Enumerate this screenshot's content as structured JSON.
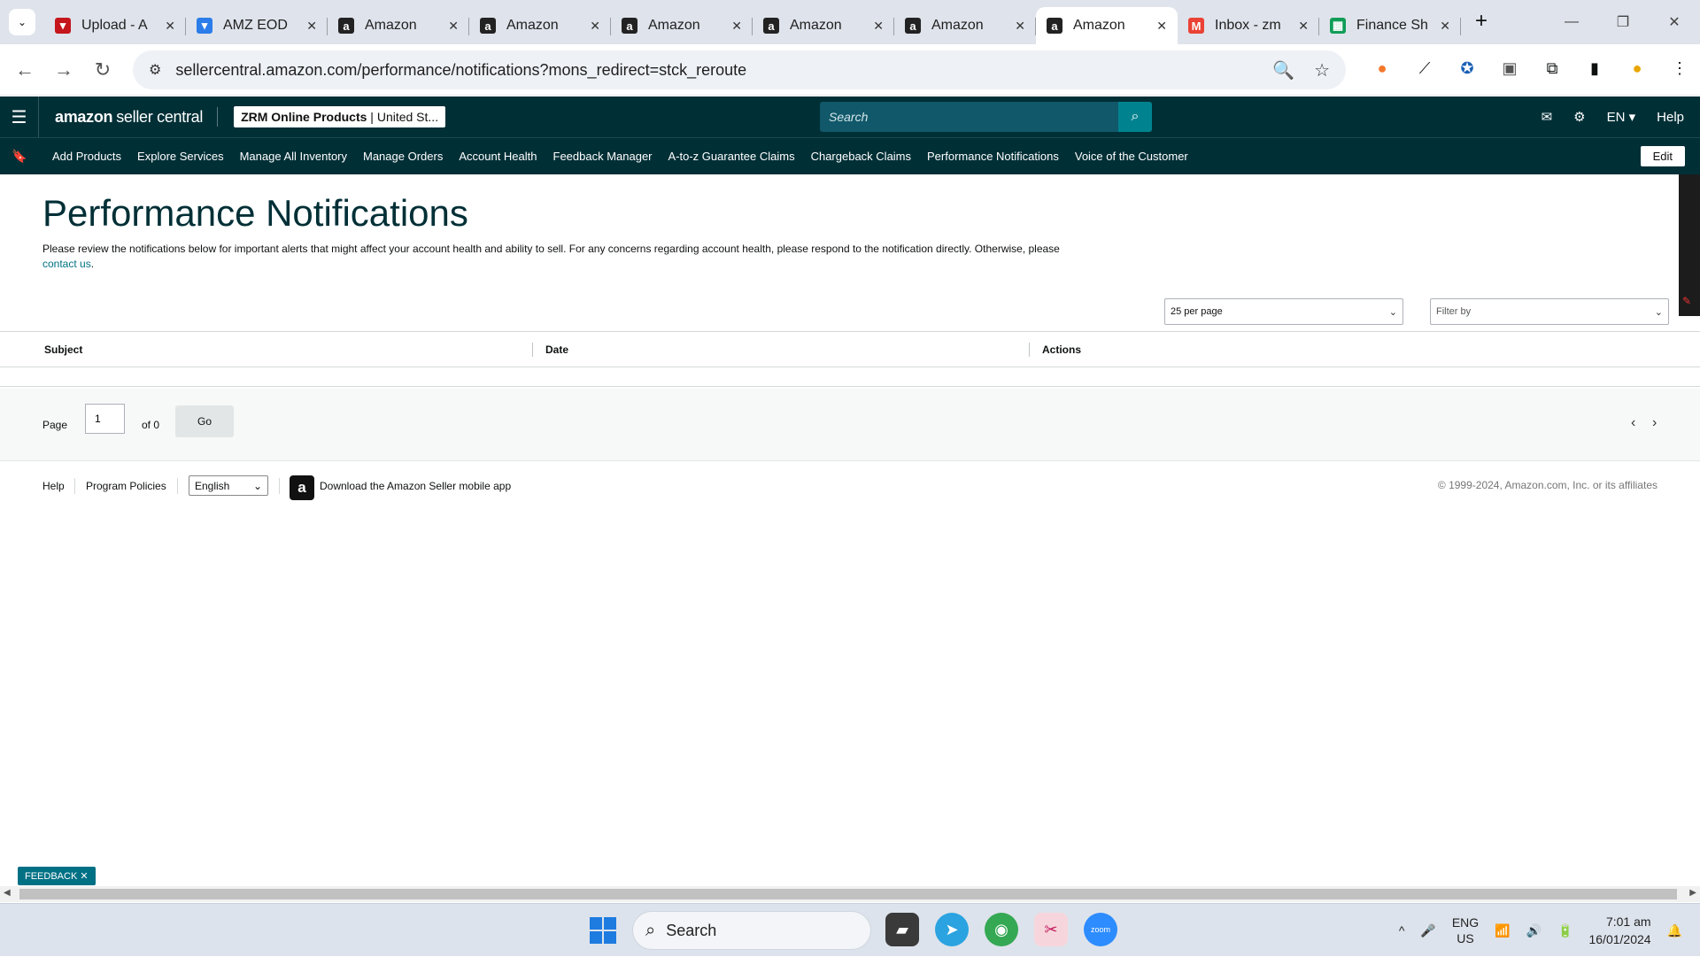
{
  "browser": {
    "tabs": [
      {
        "title": "Upload - A",
        "icon": "vpn-shield-icon",
        "color": "#c4161c"
      },
      {
        "title": "AMZ EOD",
        "icon": "brush-icon",
        "color": "#2b7de9"
      },
      {
        "title": "Amazon",
        "icon": "amazon-a-icon",
        "color": "#222222"
      },
      {
        "title": "Amazon",
        "icon": "amazon-a-icon",
        "color": "#222222"
      },
      {
        "title": "Amazon",
        "icon": "amazon-a-icon",
        "color": "#222222"
      },
      {
        "title": "Amazon",
        "icon": "amazon-a-icon",
        "color": "#222222"
      },
      {
        "title": "Amazon",
        "icon": "amazon-a-icon",
        "color": "#222222"
      },
      {
        "title": "Amazon",
        "icon": "amazon-a-icon",
        "color": "#222222",
        "active": true
      },
      {
        "title": "Inbox - zm",
        "icon": "gmail-icon",
        "color": "#ea4335"
      },
      {
        "title": "Finance Sh",
        "icon": "sheets-icon",
        "color": "#0f9d58"
      }
    ],
    "url": "sellercentral.amazon.com/performance/notifications?mons_redirect=stck_reroute"
  },
  "header": {
    "logo_main": "amazon",
    "logo_sub": "seller central",
    "store_name": "ZRM Online Products",
    "store_region": "United St...",
    "search_placeholder": "Search",
    "language": "EN",
    "help": "Help"
  },
  "nav": {
    "items": [
      "Add Products",
      "Explore Services",
      "Manage All Inventory",
      "Manage Orders",
      "Account Health",
      "Feedback Manager",
      "A-to-z Guarantee Claims",
      "Chargeback Claims",
      "Performance Notifications",
      "Voice of the Customer"
    ],
    "edit": "Edit"
  },
  "page": {
    "title": "Performance Notifications",
    "description": "Please review the notifications below for important alerts that might affect your account health and ability to sell. For any concerns regarding account health, please respond to the notification directly. Otherwise, please",
    "contact_link": "contact us",
    "per_page": "25 per page",
    "filter_placeholder": "Filter by",
    "columns": [
      "Subject",
      "Date",
      "Actions"
    ],
    "pager": {
      "page_label": "Page",
      "page_value": "1",
      "of_label": "of 0",
      "go": "Go"
    }
  },
  "footer": {
    "help": "Help",
    "policies": "Program Policies",
    "language": "English",
    "app_text": "Download the Amazon Seller mobile app",
    "copyright": "© 1999-2024, Amazon.com, Inc. or its affiliates"
  },
  "feedback": "FEEDBACK",
  "taskbar": {
    "search": "Search",
    "lang_top": "ENG",
    "lang_bottom": "US",
    "time": "7:01 am",
    "date": "16/01/2024"
  }
}
